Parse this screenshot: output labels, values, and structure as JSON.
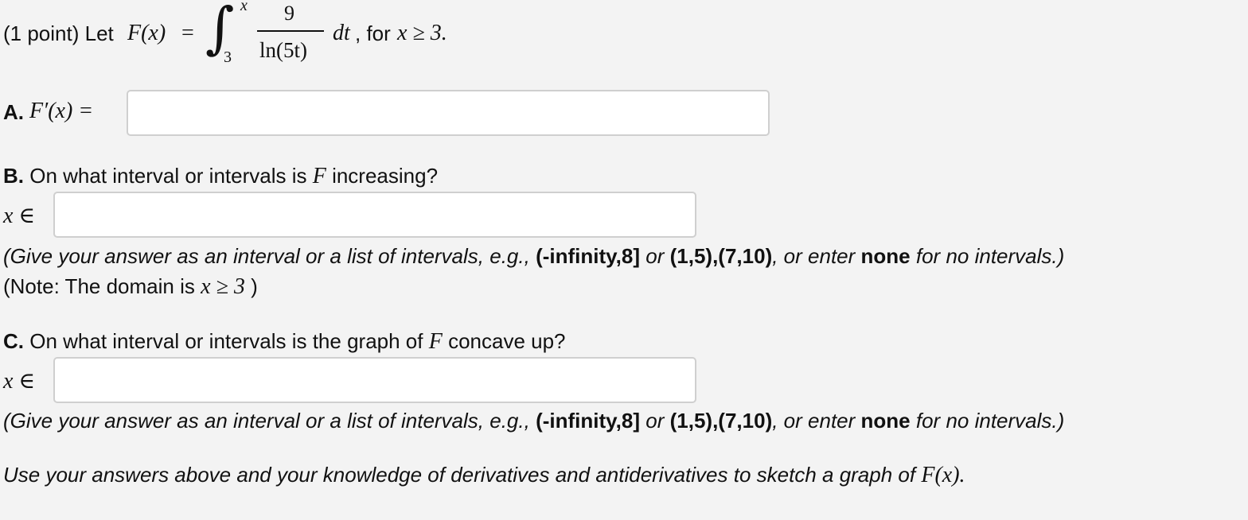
{
  "problem": {
    "points_label": "(1 point) Let",
    "F_x": "F(x)",
    "equals": "=",
    "integral_sign": "∫",
    "upper_limit": "x",
    "lower_limit": "3",
    "numerator": "9",
    "denominator": "ln(5t)",
    "dt": "dt",
    "for_text": ", for",
    "condition": "x ≥ 3."
  },
  "part_a": {
    "label": "A.",
    "expr": "F′(x) =",
    "answer_value": ""
  },
  "part_b": {
    "label": "B.",
    "question_pre": "On what interval or intervals is",
    "F": "F",
    "question_post": "increasing?",
    "x_in": "x ∈",
    "answer_value": "",
    "hint_open": "(Give your answer as an interval or a list of intervals, e.g.,",
    "example1": "(-infinity,8]",
    "hint_or": "or",
    "example2": "(1,5),(7,10)",
    "hint_mid": ", or enter",
    "none": "none",
    "hint_close": "for no intervals.)",
    "note_pre": "(Note: The domain is",
    "note_math": "x ≥ 3",
    "note_post": ")"
  },
  "part_c": {
    "label": "C.",
    "question_pre": "On what interval or intervals is the graph of",
    "F": "F",
    "question_post": "concave up?",
    "x_in": "x ∈",
    "answer_value": "",
    "hint_open": "(Give your answer as an interval or a list of intervals, e.g.,",
    "example1": "(-infinity,8]",
    "hint_or": "or",
    "example2": "(1,5),(7,10)",
    "hint_mid": ", or enter",
    "none": "none",
    "hint_close": "for no intervals.)"
  },
  "final": {
    "text": "Use your answers above and your knowledge of derivatives and antiderivatives to sketch a graph of",
    "math": "F(x)."
  }
}
